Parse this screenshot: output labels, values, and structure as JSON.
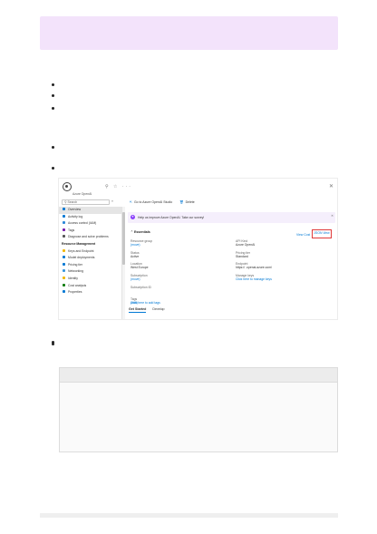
{
  "portal": {
    "resource_name": "Azure OpenAI",
    "header_icons": "⚲ ☆ ···",
    "close_glyph": "✕",
    "search": {
      "value": "Search"
    },
    "collapse_glyph": "«",
    "nav": [
      {
        "label": "Overview",
        "active": true,
        "color": "#0078d4"
      },
      {
        "label": "Activity log",
        "color": "#0078d4"
      },
      {
        "label": "Access control (IAM)",
        "color": "#2b88d8"
      },
      {
        "label": "Tags",
        "color": "#7719aa"
      },
      {
        "label": "Diagnose and solve problems",
        "color": "#555555"
      },
      {
        "label": "Resource Management",
        "section": true
      },
      {
        "label": "Keys and Endpoint",
        "color": "#f2b705"
      },
      {
        "label": "Model deployments",
        "color": "#0078d4"
      },
      {
        "label": "Pricing tier",
        "color": "#0078d4"
      },
      {
        "label": "Networking",
        "color": "#3a96dd"
      },
      {
        "label": "Identity",
        "color": "#f2b705"
      },
      {
        "label": "Cost analysis",
        "color": "#107c10"
      },
      {
        "label": "Properties",
        "color": "#0078d4"
      }
    ],
    "toolbar": {
      "studio_icon": "⇱",
      "studio_label": "Go to Azure OpenAI Studio",
      "delete_icon": "🗑",
      "delete_label": "Delete"
    },
    "banner": {
      "icon": "✦",
      "text": "Help us improve Azure OpenAI. Take our survey!",
      "close": "✕"
    },
    "essentials_heading": "⌃ Essentials",
    "view_cost": "View Cost",
    "json_view": "JSON View",
    "left_fields": [
      {
        "label": "Resource group",
        "value": "(move)",
        "link": true
      },
      {
        "label": "Status",
        "value": "Active"
      },
      {
        "label": "Location",
        "value": "West Europe"
      },
      {
        "label": "Subscription",
        "value": "(move)",
        "link": true
      },
      {
        "label": "Subscription ID",
        "value": ""
      },
      {
        "label": "Tags",
        "value": "(edit)",
        "link": true
      },
      {
        "label": "",
        "value": "Click here to add tags",
        "link": true
      }
    ],
    "right_fields": [
      {
        "label": "API Kind",
        "value": "Azure OpenAI"
      },
      {
        "label": "Pricing tier",
        "value": "Standard"
      },
      {
        "label": "Endpoint",
        "value": "https://        .openai.azure.com/"
      },
      {
        "label": "Manage keys",
        "value": "Click here to manage keys",
        "link": true
      }
    ],
    "tabs": [
      {
        "label": "Get Started",
        "active": true
      },
      {
        "label": "Develop"
      }
    ]
  },
  "colors": {
    "callout_bg": "#f3e3fb",
    "accent": "#0078d4",
    "highlight_box": "#e03a3a"
  }
}
